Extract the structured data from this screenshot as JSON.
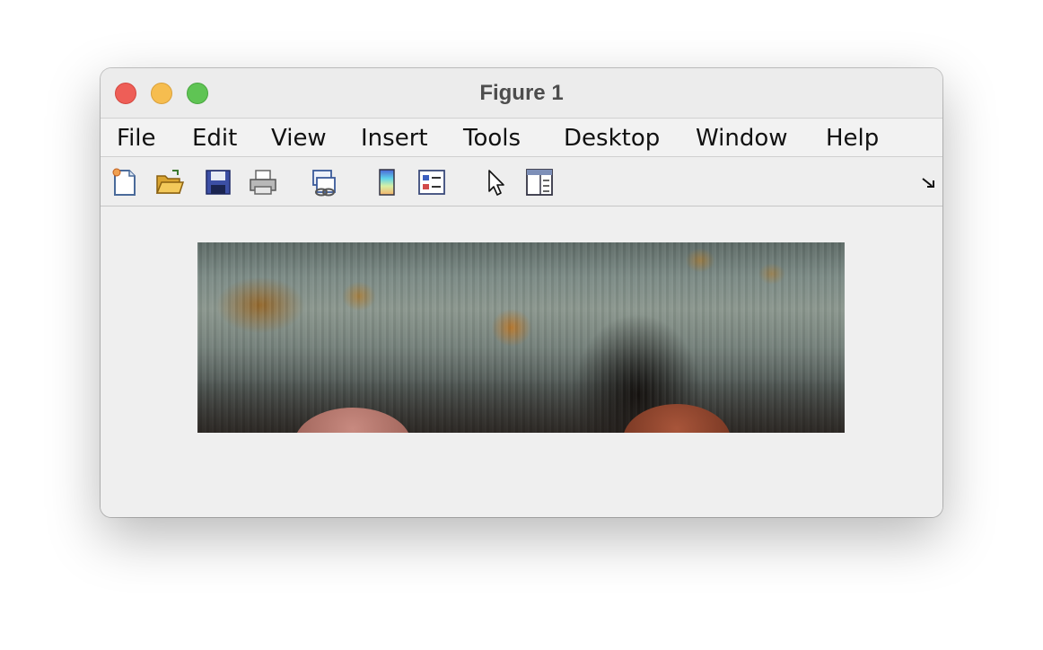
{
  "window": {
    "title": "Figure 1"
  },
  "menubar": {
    "items": [
      "File",
      "Edit",
      "View",
      "Insert",
      "Tools",
      "Desktop",
      "Window",
      "Help"
    ]
  },
  "toolbar": {
    "buttons": [
      {
        "name": "new-figure-icon"
      },
      {
        "name": "open-file-icon"
      },
      {
        "name": "save-figure-icon"
      },
      {
        "name": "print-figure-icon"
      },
      {
        "name": "link-plot-icon"
      },
      {
        "name": "insert-colorbar-icon"
      },
      {
        "name": "insert-legend-icon"
      },
      {
        "name": "edit-plot-pointer-icon"
      },
      {
        "name": "property-inspector-icon"
      }
    ],
    "dock_icon": "dock-arrow-icon"
  },
  "figure": {
    "content": "image-display"
  }
}
